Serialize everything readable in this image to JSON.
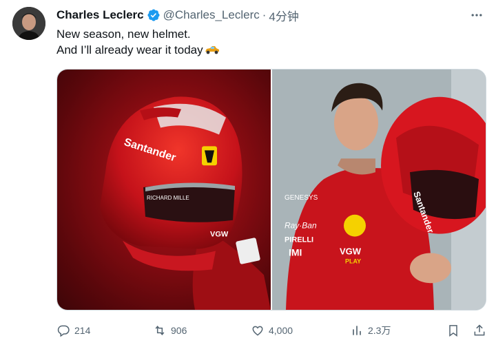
{
  "tweet": {
    "author_name": "Charles Leclerc",
    "handle": "@Charles_Leclerc",
    "separator": "·",
    "time": "4分钟",
    "text_line1": "New season, new helmet.",
    "text_line2": "And I’ll already wear it today",
    "emoji_icon": "race-car-icon"
  },
  "actions": {
    "replies": "214",
    "retweets": "906",
    "likes": "4,000",
    "views": "2.3万"
  },
  "colors": {
    "verified": "#1d9bf0",
    "muted": "#536471",
    "ferrari_red": "#d8121b"
  },
  "icons": [
    "reply-icon",
    "retweet-icon",
    "like-icon",
    "views-icon",
    "bookmark-icon",
    "share-icon",
    "more-icon",
    "verified-badge-icon"
  ]
}
